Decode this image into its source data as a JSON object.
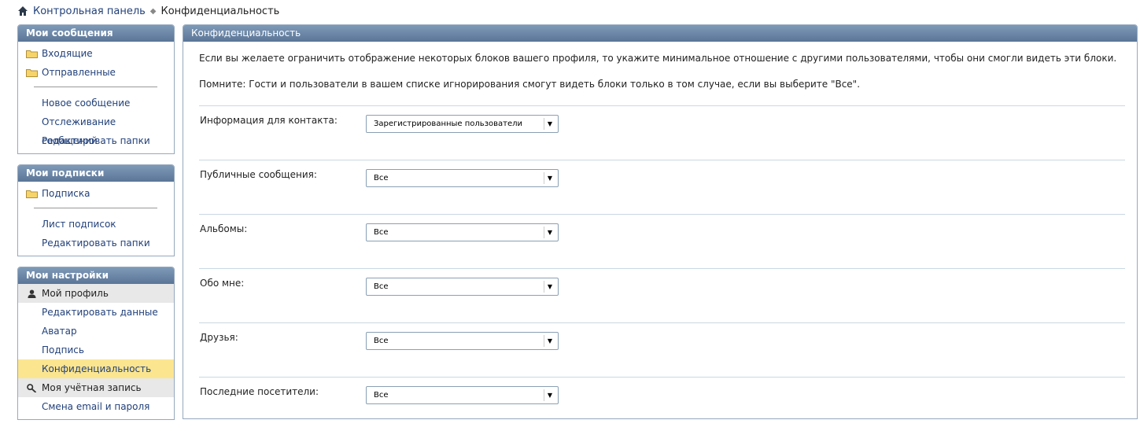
{
  "breadcrumb": {
    "home": "Контрольная панель",
    "current": "Конфиденциальность"
  },
  "sidebar": {
    "messages": {
      "title": "Мои сообщения",
      "folders": [
        "Входящие",
        "Отправленные"
      ],
      "links": [
        "Новое сообщение",
        "Отслеживание сообщений",
        "Редактировать папки"
      ]
    },
    "subscriptions": {
      "title": "Мои подписки",
      "folders": [
        "Подписка"
      ],
      "links": [
        "Лист подписок",
        "Редактировать папки"
      ]
    },
    "settings": {
      "title": "Мои настройки",
      "profile_section": "Мой профиль",
      "profile_links": [
        "Редактировать данные",
        "Аватар",
        "Подпись",
        "Конфиденциальность"
      ],
      "account_section": "Моя учётная запись",
      "account_links": [
        "Смена email и пароля"
      ]
    }
  },
  "main": {
    "title": "Конфиденциальность",
    "intro": "Если вы желаете ограничить отображение некоторых блоков вашего профиля, то укажите минимальное отношение с другими пользователями, чтобы они смогли видеть эти блоки.",
    "note": "Помните: Гости и пользователи в вашем списке игнорирования смогут видеть блоки только в том случае, если вы выберите \"Все\".",
    "rows": [
      {
        "label": "Информация для контакта:",
        "value": "Зарегистрированные пользователи"
      },
      {
        "label": "Публичные сообщения:",
        "value": "Все"
      },
      {
        "label": "Альбомы:",
        "value": "Все"
      },
      {
        "label": "Обо мне:",
        "value": "Все"
      },
      {
        "label": "Друзья:",
        "value": "Все"
      },
      {
        "label": "Последние посетители:",
        "value": "Все"
      }
    ]
  }
}
